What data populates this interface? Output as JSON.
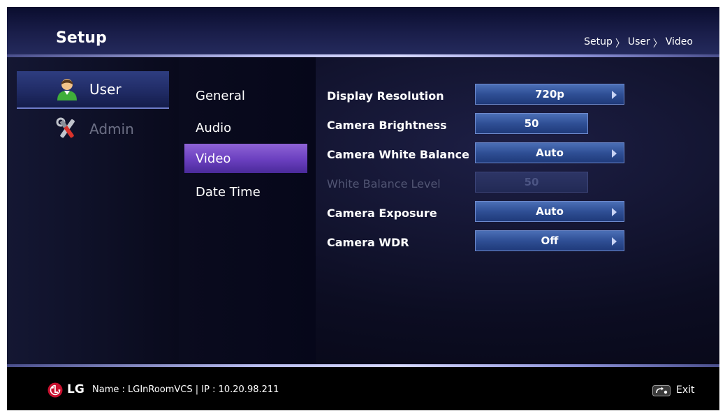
{
  "header": {
    "title": "Setup",
    "breadcrumb": [
      "Setup",
      "User",
      "Video"
    ],
    "breadcrumb_sep": "〉"
  },
  "sidebar": {
    "items": [
      {
        "label": "User",
        "icon": "user-icon",
        "selected": true,
        "enabled": true
      },
      {
        "label": "Admin",
        "icon": "tools-icon",
        "selected": false,
        "enabled": false
      }
    ]
  },
  "submenu": {
    "items": [
      {
        "label": "General",
        "selected": false
      },
      {
        "label": "Audio",
        "selected": false
      },
      {
        "label": "Video",
        "selected": true
      },
      {
        "label": "Date Time",
        "selected": false
      }
    ]
  },
  "settings": [
    {
      "label": "Display Resolution",
      "value": "720p",
      "type": "dropdown",
      "enabled": true
    },
    {
      "label": "Camera Brightness",
      "value": "50",
      "type": "number",
      "enabled": true
    },
    {
      "label": "Camera White Balance",
      "value": "Auto",
      "type": "dropdown",
      "enabled": true
    },
    {
      "label": "White Balance Level",
      "value": "50",
      "type": "number",
      "enabled": false
    },
    {
      "label": "Camera Exposure",
      "value": "Auto",
      "type": "dropdown",
      "enabled": true
    },
    {
      "label": "Camera WDR",
      "value": "Off",
      "type": "dropdown",
      "enabled": true
    }
  ],
  "footer": {
    "brand": "LG",
    "info": "Name : LGInRoomVCS  |  IP : 10.20.98.211",
    "exit_label": "Exit",
    "exit_icon": "return-icon"
  },
  "colors": {
    "accent_selected_submenu": "#6a3fbf",
    "control_blue": "#2f4f95",
    "brand_red": "#c8102e"
  }
}
